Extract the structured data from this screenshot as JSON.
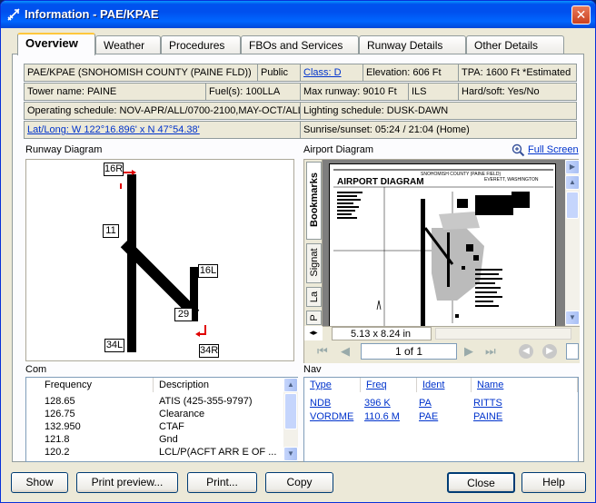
{
  "window": {
    "title": "Information - PAE/KPAE",
    "close_glyph": "✕"
  },
  "tabs": [
    {
      "label": "Overview"
    },
    {
      "label": "Weather"
    },
    {
      "label": "Procedures"
    },
    {
      "label": "FBOs and Services"
    },
    {
      "label": "Runway Details"
    },
    {
      "label": "Other Details"
    }
  ],
  "info": {
    "name": "PAE/KPAE (SNOHOMISH COUNTY (PAINE FLD))",
    "use": "Public",
    "airspace_class": "Class: D",
    "elevation": "Elevation: 606 Ft",
    "tpa": "TPA: 1600 Ft *Estimated",
    "tower": "Tower name: PAINE",
    "fuel": "Fuel(s): 100LLA",
    "max_runway": "Max runway: 9010 Ft",
    "approach": "ILS",
    "surface": "Hard/soft: Yes/No",
    "schedule": "Operating schedule: NOV-APR/ALL/0700-2100,MAY-OCT/ALL/0",
    "lighting": "Lighting schedule: DUSK-DAWN",
    "latlong": "Lat/Long: W 122°16.896' x N 47°54.38'",
    "sun": "Sunrise/sunset: 05:24 / 21:04 (Home)"
  },
  "runway_diagram": {
    "title": "Runway Diagram",
    "labels": [
      "16R",
      "11",
      "16L",
      "29",
      "34L",
      "34R"
    ]
  },
  "airport_diagram": {
    "title": "Airport Diagram",
    "full_screen": "Full Screen",
    "side_tabs": [
      "Bookmarks",
      "Signat",
      "La",
      "P"
    ],
    "page_size": "5.13 x 8.24 in",
    "page_indicator": "1 of 1",
    "heading": "AIRPORT DIAGRAM",
    "location": "EVERETT, WASHINGTON",
    "airport": "SNOHOMISH COUNTY (PAINE FIELD)"
  },
  "com": {
    "title": "Com",
    "headers": [
      "Frequency",
      "Description"
    ],
    "rows": [
      {
        "freq": "128.65",
        "desc": "ATIS (425-355-9797)"
      },
      {
        "freq": "126.75",
        "desc": "Clearance"
      },
      {
        "freq": "132.950",
        "desc": "CTAF"
      },
      {
        "freq": "121.8",
        "desc": "Gnd"
      },
      {
        "freq": "120.2",
        "desc": "LCL/P(ACFT ARR E OF ..."
      }
    ]
  },
  "nav": {
    "title": "Nav",
    "headers": [
      "Type",
      "Freq",
      "Ident",
      "Name"
    ],
    "rows": [
      {
        "type": "NDB",
        "freq": "396 K",
        "ident": "PA",
        "name": "RITTS"
      },
      {
        "type": "VORDME",
        "freq": "110.6 M",
        "ident": "PAE",
        "name": "PAINE"
      }
    ]
  },
  "buttons": {
    "show": "Show",
    "print_preview": "Print preview...",
    "print": "Print...",
    "copy": "Copy",
    "close": "Close",
    "help": "Help"
  },
  "colors": {
    "title_bar": "#0053ee",
    "link": "#0033cc",
    "runway_marker": "#e00000"
  }
}
